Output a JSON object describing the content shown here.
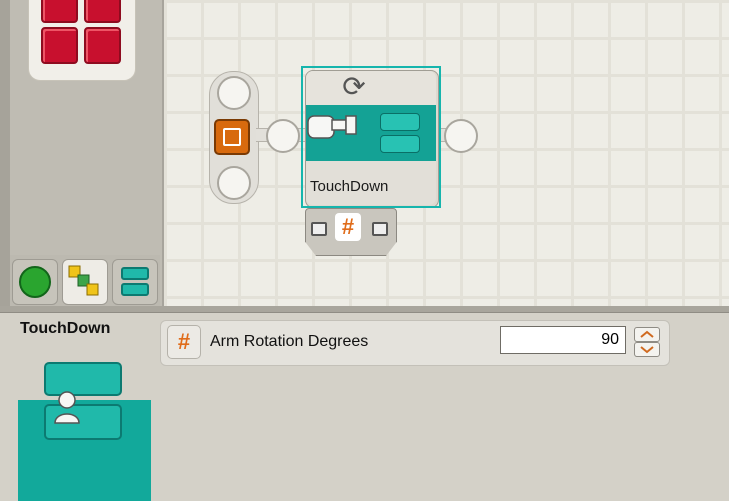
{
  "program": {
    "block_name": "TouchDown"
  },
  "config": {
    "title": "TouchDown",
    "param": {
      "label": "Arm Rotation Degrees",
      "value": "90",
      "icon": "hash-icon"
    }
  },
  "icons": {
    "start": "start-block-icon",
    "rotate": "rotate-icon",
    "hand": "motor-hand-icon"
  },
  "colors": {
    "teal": "#14a295",
    "selection": "#16b5ad",
    "start_orange": "#d86a0e",
    "palette_red": "#c8102e"
  }
}
